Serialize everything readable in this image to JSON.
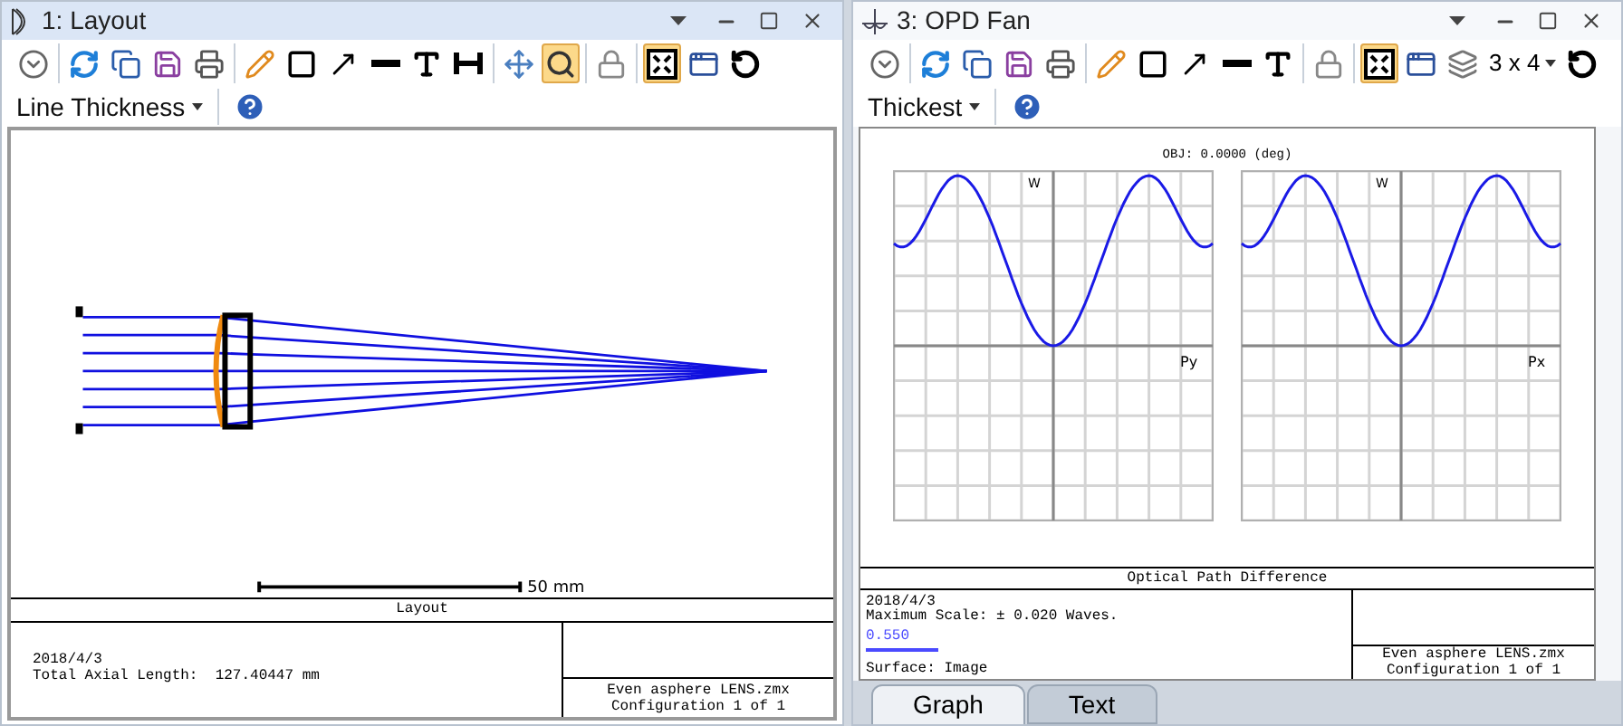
{
  "panes": [
    {
      "title": "1: Layout",
      "kind": "layout",
      "active": true,
      "toolbar": [
        [
          {
            "kind": "menu",
            "selected": false
          }
        ],
        [
          {
            "kind": "refresh",
            "selected": false
          },
          {
            "kind": "copy",
            "selected": false
          },
          {
            "kind": "save",
            "selected": false
          },
          {
            "kind": "print",
            "selected": false
          }
        ],
        [
          {
            "kind": "pencil",
            "selected": false
          },
          {
            "kind": "rectangle",
            "selected": false
          },
          {
            "kind": "arrow",
            "selected": false
          },
          {
            "kind": "line",
            "selected": false
          },
          {
            "kind": "text",
            "selected": false
          },
          {
            "kind": "dimension",
            "selected": false
          }
        ],
        [
          {
            "kind": "pan",
            "selected": false
          },
          {
            "kind": "zoom",
            "selected": true
          }
        ],
        [
          {
            "kind": "lock",
            "selected": false
          }
        ],
        [
          {
            "kind": "fit",
            "selected": true
          },
          {
            "kind": "window",
            "selected": false
          },
          {
            "kind": "reset",
            "selected": false
          }
        ]
      ],
      "option_dropdown": "Line Thickness",
      "scale_label": "50 mm",
      "footer": {
        "title": "Layout",
        "lines": [
          "2018/4/3",
          "Total Axial Length:  127.40447 mm"
        ],
        "file": "Even asphere LENS.zmx",
        "config": "Configuration 1 of 1"
      }
    },
    {
      "title": "3: OPD Fan",
      "kind": "opd_fan",
      "active": false,
      "toolbar": [
        [
          {
            "kind": "menu",
            "selected": false
          }
        ],
        [
          {
            "kind": "refresh",
            "selected": false
          },
          {
            "kind": "copy",
            "selected": false
          },
          {
            "kind": "save",
            "selected": false
          },
          {
            "kind": "print",
            "selected": false
          }
        ],
        [
          {
            "kind": "pencil",
            "selected": false
          },
          {
            "kind": "rectangle",
            "selected": false
          },
          {
            "kind": "arrow",
            "selected": false
          },
          {
            "kind": "line",
            "selected": false
          },
          {
            "kind": "text",
            "selected": false
          }
        ],
        [
          {
            "kind": "lock",
            "selected": false
          }
        ],
        [
          {
            "kind": "fit",
            "selected": true
          },
          {
            "kind": "window",
            "selected": false
          },
          {
            "kind": "layers",
            "selected": false
          },
          {
            "kind": "dropdown",
            "label": "3 x 4"
          },
          {
            "kind": "reset",
            "selected": false
          }
        ]
      ],
      "option_dropdown": "Thickest",
      "plot_header": "OBJ: 0.0000 (deg)",
      "plots": [
        {
          "v_label": "W",
          "h_label": "Py"
        },
        {
          "v_label": "W",
          "h_label": "Px"
        }
      ],
      "footer": {
        "title": "Optical Path Difference",
        "lines": [
          "2018/4/3",
          "Maximum Scale: ± 0.020 Waves."
        ],
        "wavelengths": [
          {
            "label": "0.550",
            "color": "#4a4aff"
          }
        ],
        "surface": "Surface: Image",
        "file": "Even asphere LENS.zmx",
        "config": "Configuration 1 of 1"
      },
      "tabs": [
        {
          "label": "Graph",
          "selected": true
        },
        {
          "label": "Text",
          "selected": false
        }
      ]
    }
  ]
}
